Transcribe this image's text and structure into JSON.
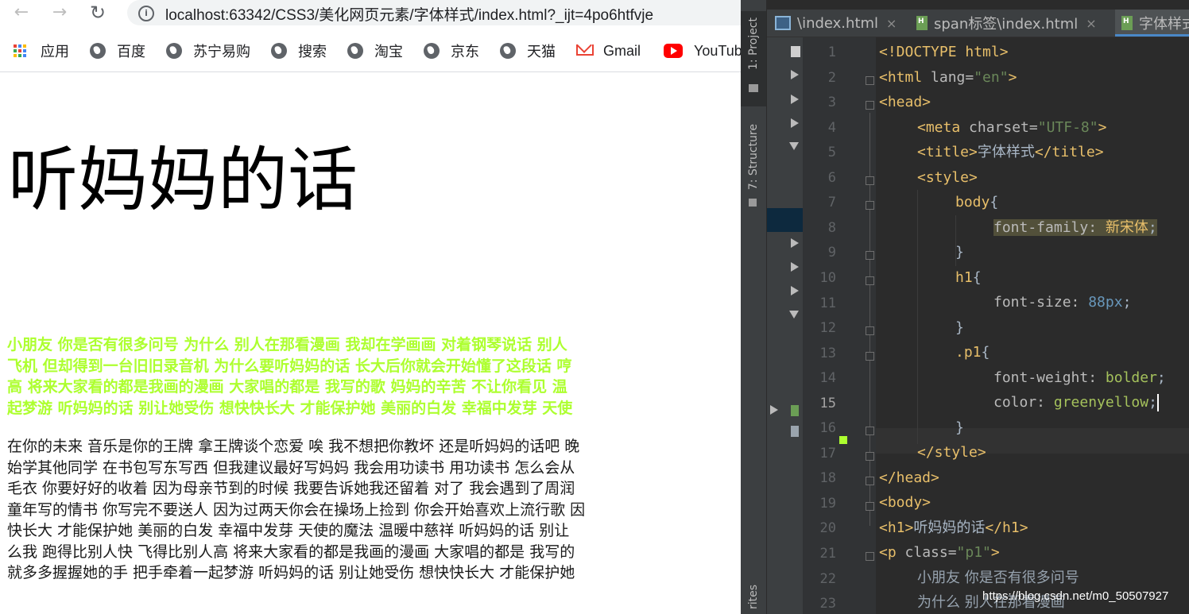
{
  "browser": {
    "url": "localhost:63342/CSS3/美化网页元素/字体样式/index.html?_ijt=4po6htfvje",
    "bookmarks": [
      {
        "label": "应用",
        "icon": "apps-grid-icon"
      },
      {
        "label": "百度",
        "icon": "globe-icon"
      },
      {
        "label": "苏宁易购",
        "icon": "globe-icon"
      },
      {
        "label": "搜索",
        "icon": "globe-icon"
      },
      {
        "label": "淘宝",
        "icon": "globe-icon"
      },
      {
        "label": "京东",
        "icon": "globe-icon"
      },
      {
        "label": "天猫",
        "icon": "globe-icon"
      },
      {
        "label": "Gmail",
        "icon": "gmail-icon"
      },
      {
        "label": "YouTube",
        "icon": "youtube-icon"
      }
    ]
  },
  "page": {
    "heading": "听妈妈的话",
    "p1_lines": [
      "小朋友 你是否有很多问号 为什么 别人在那看漫画 我却在学画画 对着钢琴说话 别人",
      "飞机 但却得到一台旧旧录音机 为什么要听妈妈的话 长大后你就会开始懂了这段话 哼",
      "高 将来大家看的都是我画的漫画 大家唱的都是 我写的歌 妈妈的辛苦 不让你看见 温",
      "起梦游 听妈妈的话 别让她受伤 想快快长大 才能保护她 美丽的白发 幸福中发芽 天使"
    ],
    "p1_color": "#adff2f",
    "p2_lines": [
      "在你的未来 音乐是你的王牌 拿王牌谈个恋爱 唉 我不想把你教坏 还是听妈妈的话吧 晚",
      "始学其他同学 在书包写东写西 但我建议最好写妈妈 我会用功读书 用功读书 怎么会从",
      "毛衣 你要好好的收着 因为母亲节到的时候 我要告诉她我还留着 对了 我会遇到了周润",
      "童年写的情书 你写完不要送人 因为过两天你会在操场上捡到 你会开始喜欢上流行歌 因",
      "快长大 才能保护她 美丽的白发 幸福中发芽 天使的魔法 温暖中慈祥 听妈妈的话 别让",
      "么我 跑得比别人快 飞得比别人高 将来大家看的都是我画的漫画 大家唱的都是 我写的",
      "就多多握握她的手 把手牵着一起梦游 听妈妈的话 别让她受伤 想快快长大 才能保护她"
    ]
  },
  "ide": {
    "tool_tabs": [
      "1: Project",
      "7: Structure",
      "rites"
    ],
    "editor_tabs": [
      {
        "label": "\\index.html",
        "active": false
      },
      {
        "label": "span标签\\index.html",
        "active": false
      },
      {
        "label": "字体样式",
        "active": true
      }
    ],
    "current_line": 15,
    "line_numbers": [
      "1",
      "2",
      "3",
      "4",
      "5",
      "6",
      "7",
      "8",
      "9",
      "10",
      "11",
      "12",
      "13",
      "14",
      "15",
      "16",
      "17",
      "18",
      "19",
      "20",
      "21",
      "22",
      "23"
    ],
    "code": {
      "l1": "<!DOCTYPE html>",
      "l2a": "<html ",
      "l2b": "lang=",
      "l2c": "\"en\"",
      "l2d": ">",
      "l3": "<head>",
      "l4a": "<meta ",
      "l4b": "charset=",
      "l4c": "\"UTF-8\"",
      "l4d": ">",
      "l5a": "<title>",
      "l5b": "字体样式",
      "l5c": "</title>",
      "l6": "<style>",
      "l7a": "body",
      "l7b": "{",
      "l8a": "font-family: ",
      "l8b": "新宋体",
      "l8c": ";",
      "l9": "}",
      "l10a": "h1",
      "l10b": "{",
      "l11a": "font-size: ",
      "l11b": "88px",
      "l11c": ";",
      "l12": "}",
      "l13a": ".p1",
      "l13b": "{",
      "l14a": "font-weight: ",
      "l14b": "bolder",
      "l14c": ";",
      "l15a": "color: ",
      "l15b": "greenyellow",
      "l15c": ";",
      "l16": "}",
      "l17": "</style>",
      "l18": "</head>",
      "l19": "<body>",
      "l20a": "<h1>",
      "l20b": "听妈妈的话",
      "l20c": "</h1>",
      "l21a": "<p ",
      "l21b": "class=",
      "l21c": "\"p1\"",
      "l21d": ">",
      "l22": "小朋友 你是否有很多问号",
      "l23": "为什么 别人在那看漫画"
    }
  },
  "watermark": "https://blog.csdn.net/m0_50507927"
}
